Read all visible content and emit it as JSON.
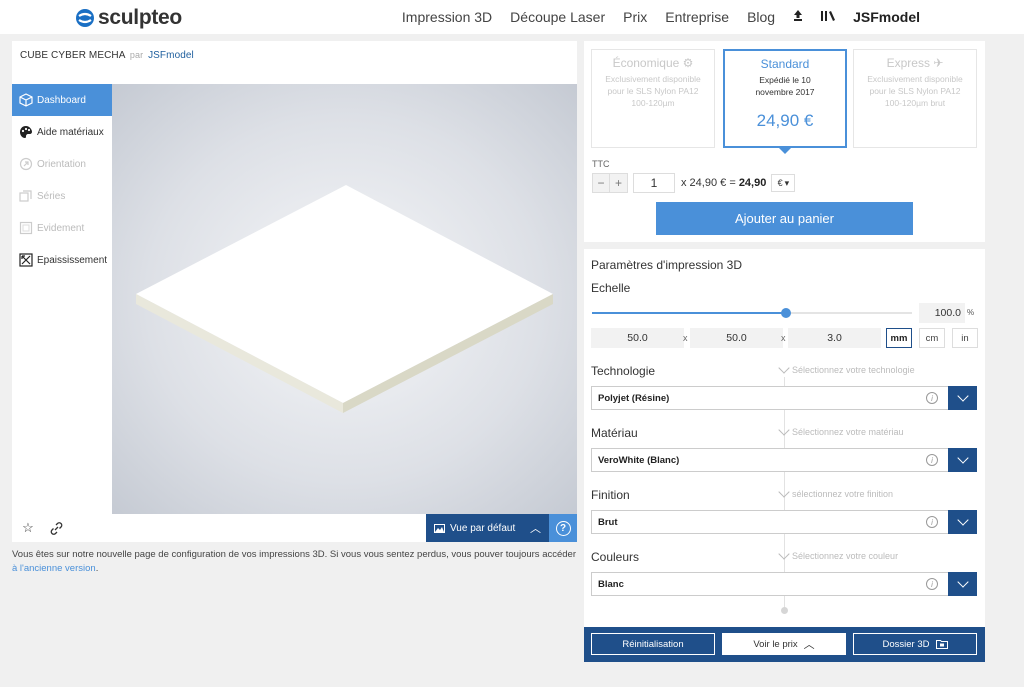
{
  "header": {
    "brand": "sculpteo",
    "nav": [
      "Impression 3D",
      "Découpe Laser",
      "Prix",
      "Entreprise",
      "Blog"
    ],
    "upload_icon": "upload-icon",
    "library_icon": "library-icon",
    "user": "JSFmodel"
  },
  "project": {
    "title": "CUBE CYBER MECHA",
    "by": "par",
    "owner": "JSFmodel"
  },
  "sidebar": {
    "items": [
      {
        "label": "Dashboard",
        "icon": "cube-icon",
        "state": "active"
      },
      {
        "label": "Aide matériaux",
        "icon": "palette-icon",
        "state": "normal"
      },
      {
        "label": "Orientation",
        "icon": "orientation-icon",
        "state": "disabled"
      },
      {
        "label": "Séries",
        "icon": "series-icon",
        "state": "disabled"
      },
      {
        "label": "Evidement",
        "icon": "hollow-icon",
        "state": "disabled"
      },
      {
        "label": "Epaississement",
        "icon": "thickening-icon",
        "state": "normal"
      }
    ]
  },
  "viewer": {
    "view_label": "Vue par défaut",
    "help": "?"
  },
  "notice": {
    "text": "Vous êtes sur notre nouvelle page de configuration de vos impressions 3D. Si vous vous sentez perdus, vous pouver toujours accéder ",
    "link": "à l'ancienne version",
    "end": "."
  },
  "pricing": {
    "options": [
      {
        "name": "Économique",
        "desc": "Exclusivement disponible pour le SLS Nylon PA12 100-120µm",
        "state": "disabled"
      },
      {
        "name": "Standard",
        "desc": "Expédié le 10 novembre 2017",
        "price": "24,90 €",
        "state": "selected"
      },
      {
        "name": "Express",
        "desc": "Exclusivement disponible pour le SLS Nylon PA12 100-120µm brut",
        "state": "disabled"
      }
    ],
    "ttc": "TTC",
    "minus": "−",
    "plus": "+",
    "quantity": "1",
    "unit_formula": "x 24,90 € =",
    "total": "24,90",
    "currency": "€",
    "add_to_cart": "Ajouter au panier"
  },
  "params": {
    "title": "Paramètres d'impression 3D",
    "scale_label": "Echelle",
    "scale_fraction": 0.606,
    "scale_value": "100.0",
    "scale_unit": "%",
    "dims": [
      "50.0",
      "50.0",
      "3.0"
    ],
    "dim_sep": "x",
    "units": [
      "mm",
      "cm",
      "in"
    ],
    "active_unit": "mm",
    "sections": [
      {
        "label": "Technologie",
        "hint": "Sélectionnez votre technologie",
        "value": "Polyjet (Résine)"
      },
      {
        "label": "Matériau",
        "hint": "Sélectionnez votre matériau",
        "value": "VeroWhite (Blanc)"
      },
      {
        "label": "Finition",
        "hint": "sélectionnez votre finition",
        "value": "Brut"
      },
      {
        "label": "Couleurs",
        "hint": "Sélectionnez votre couleur",
        "value": "Blanc"
      }
    ]
  },
  "footer": {
    "reset": "Réinitialisation",
    "price": "Voir le prix",
    "folder": "Dossier 3D"
  },
  "colors": {
    "accent": "#4a90d9",
    "dark": "#1f4f8a"
  }
}
